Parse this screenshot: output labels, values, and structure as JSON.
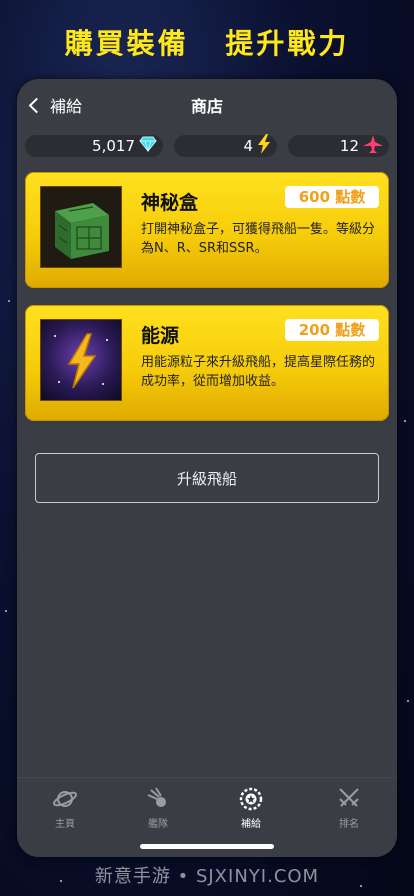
{
  "promo": {
    "title_left": "購買裝備",
    "title_right": "提升戰力"
  },
  "navbar": {
    "back_label": "補給",
    "title": "商店"
  },
  "resources": {
    "gems": "5,017",
    "energy": "4",
    "ships": "12"
  },
  "cards": [
    {
      "name": "神秘盒",
      "price": "600 點數",
      "description": "打開神秘盒子，可獲得飛船一隻。等級分為N、R、SR和SSR。"
    },
    {
      "name": "能源",
      "price": "200 點數",
      "description": "用能源粒子來升級飛船，提高星際任務的成功率，從而增加收益。"
    }
  ],
  "upgrade_button": "升級飛船",
  "tabbar": [
    {
      "label": "主頁",
      "icon": "planet-icon",
      "active": false
    },
    {
      "label": "艦隊",
      "icon": "comet-icon",
      "active": false
    },
    {
      "label": "補給",
      "icon": "supply-icon",
      "active": true
    },
    {
      "label": "排名",
      "icon": "swords-icon",
      "active": false
    }
  ],
  "watermark": "新意手游 • SJXINYI.COM",
  "colors": {
    "accent_yellow": "#ffe81a",
    "card_gold": "#f6cc0a",
    "price_orange": "#f0a01a",
    "panel": "#3a3d44"
  }
}
